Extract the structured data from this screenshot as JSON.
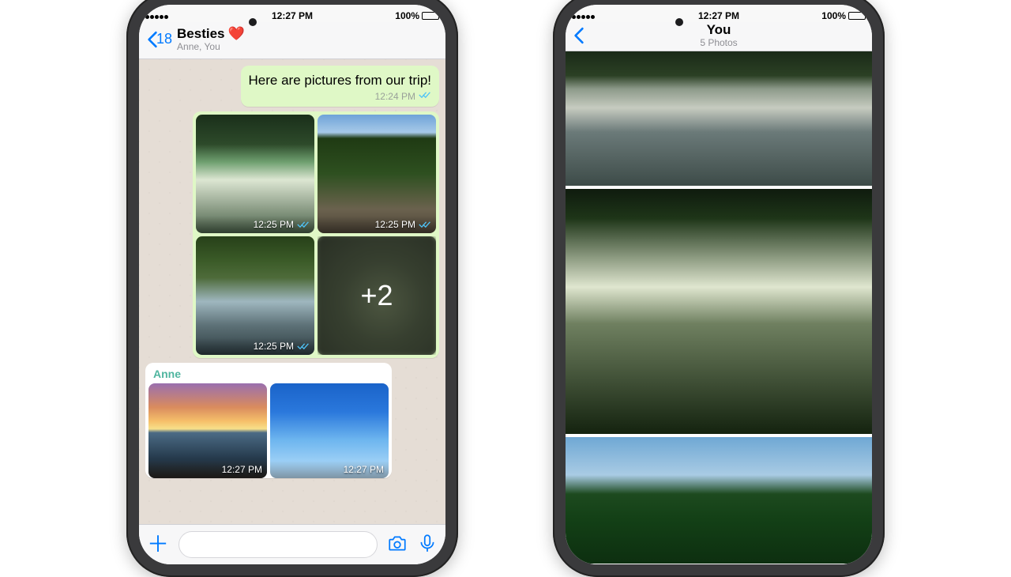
{
  "status": {
    "time": "12:27 PM",
    "battery_pct": "100%"
  },
  "chat": {
    "back_count": "18",
    "title": "Besties",
    "title_emoji": "❤️",
    "subtitle": "Anne, You",
    "message": {
      "text": "Here are pictures from our trip!",
      "time": "12:24 PM"
    },
    "album_out": {
      "t1": "12:25 PM",
      "t2": "12:25 PM",
      "t3": "12:25 PM",
      "more_label": "+2"
    },
    "album_in": {
      "sender": "Anne",
      "t1": "12:27 PM",
      "t2": "12:27 PM"
    }
  },
  "gallery": {
    "title": "You",
    "subtitle": "5 Photos"
  }
}
